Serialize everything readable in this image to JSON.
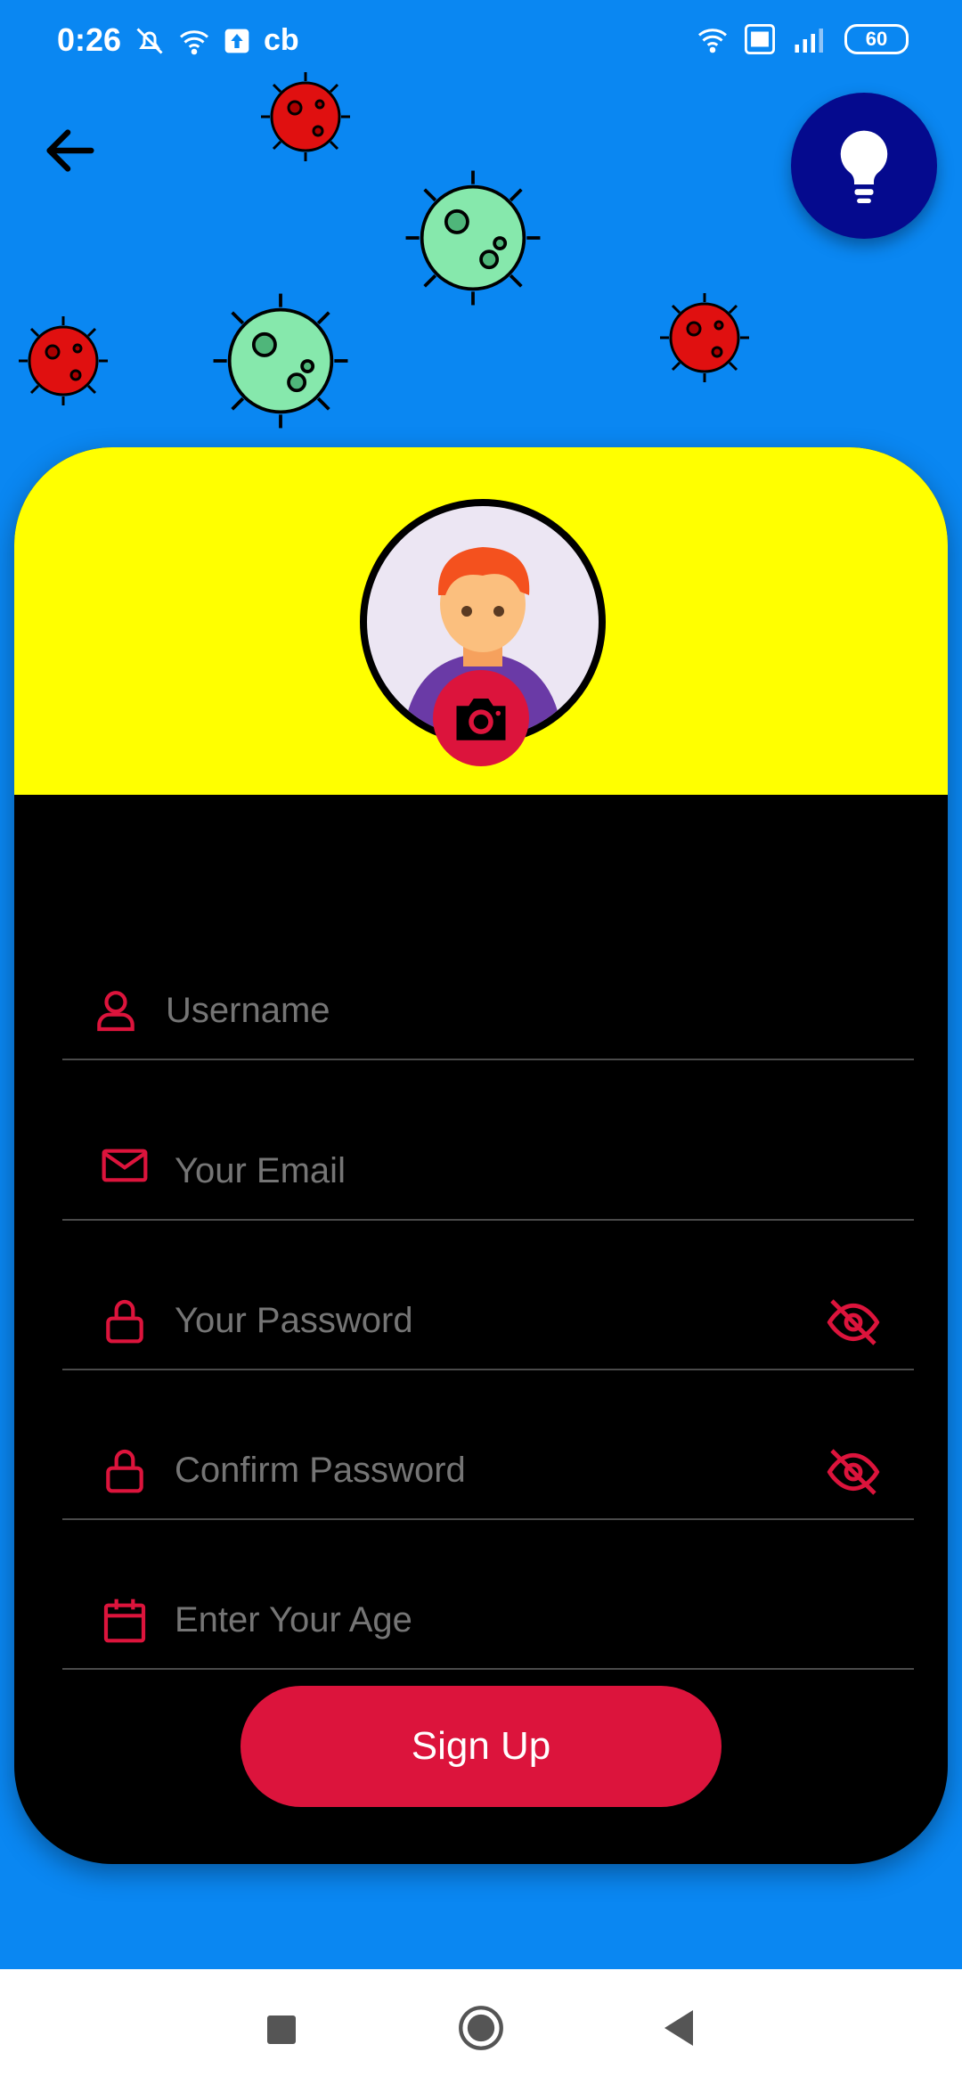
{
  "colors": {
    "background": "#0a87f2",
    "card_header": "#ffff00",
    "card_body": "#000000",
    "accent": "#dc143c",
    "bulb_button": "#050a8e",
    "placeholder_text": "#8a8a8a"
  },
  "status_bar": {
    "time": "0:26",
    "carrier_badge": "cb",
    "battery": "60",
    "left_icons": [
      "mute-icon",
      "wifi-icon",
      "upload-icon"
    ],
    "right_icons": [
      "wifi-icon",
      "volte-icon",
      "signal-4g-icon",
      "battery-icon"
    ]
  },
  "header": {
    "back_icon": "arrow-left-icon",
    "theme_icon": "lightbulb-icon"
  },
  "decorations": [
    "virus-icon-red",
    "virus-icon-green"
  ],
  "profile": {
    "avatar_icon": "user-avatar-icon",
    "camera_icon": "camera-icon"
  },
  "form": {
    "username": {
      "placeholder": "Username",
      "icon": "user-icon"
    },
    "email": {
      "placeholder": "Your Email",
      "icon": "mail-icon"
    },
    "password": {
      "placeholder": "Your Password",
      "icon": "lock-icon",
      "toggle_icon": "eye-off-icon"
    },
    "confirm_password": {
      "placeholder": "Confirm Password",
      "icon": "lock-icon",
      "toggle_icon": "eye-off-icon"
    },
    "age": {
      "placeholder": "Enter Your Age",
      "icon": "calendar-icon"
    },
    "submit_label": "Sign Up"
  },
  "nav_bar": {
    "items": [
      "recents-icon",
      "home-icon",
      "back-icon"
    ]
  }
}
